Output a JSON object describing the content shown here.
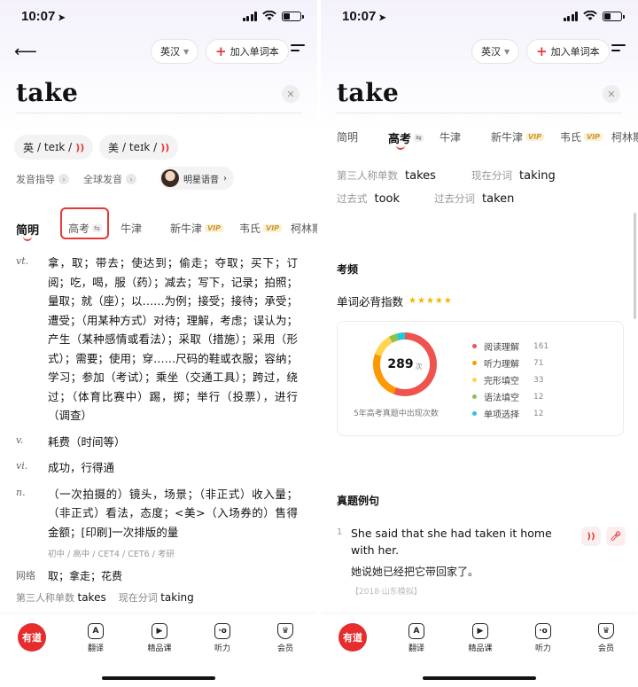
{
  "status": {
    "time": "10:07",
    "location_icon": "location-arrow-icon"
  },
  "nav": {
    "dict_selector": "英汉",
    "add_vocab": "加入单词本"
  },
  "word": "take",
  "pron": [
    {
      "region": "英",
      "ipa": "/ teɪk /"
    },
    {
      "region": "美",
      "ipa": "/ teɪk /"
    }
  ],
  "subrow": {
    "guide": "发音指导",
    "global": "全球发音",
    "celebrity": "明星语音"
  },
  "tabs": [
    {
      "label": "简明"
    },
    {
      "label": "高考"
    },
    {
      "label": "牛津"
    },
    {
      "label": "新牛津",
      "badge": "VIP"
    },
    {
      "label": "韦氏",
      "badge": "VIP"
    },
    {
      "label": "柯林斯"
    }
  ],
  "definitions": [
    {
      "pos": "vt.",
      "text": "拿，取；带去；使达到；偷走；夺取；买下；订阅；吃，喝，服（药）；减去；写下，记录；拍照；量取；就（座）；以……为例；接受；接待；承受；遭受；（用某种方式）对待；理解，考虑；误认为；产生（某种感情或看法）；采取（措施）；采用（形式）；需要；使用；穿……尺码的鞋或衣服；容纳；学习；参加（考试）；乘坐（交通工具）；跨过，绕过；（体育比赛中）踢，掷；举行（投票），进行（调查）"
    },
    {
      "pos": "v.",
      "text": "耗费（时间等）"
    },
    {
      "pos": "vi.",
      "text": "成功，行得通"
    },
    {
      "pos": "n.",
      "text": "（一次拍摄的）镜头，场景；（非正式）收入量；（非正式）看法，态度；<美>（入场券的）售得金额；[印刷]一次排版的量"
    }
  ],
  "exam_tags": "初中 / 高中 / CET4 / CET6 / 考研",
  "phrases": {
    "label": "网络",
    "text": "取；拿走；花费"
  },
  "forms": [
    {
      "label": "第三人称单数",
      "value": "takes"
    },
    {
      "label": "现在分词",
      "value": "taking"
    },
    {
      "label": "过去式",
      "value": "took"
    },
    {
      "label": "过去分词",
      "value": "taken"
    }
  ],
  "freq": {
    "section": "考频",
    "recite_label": "单词必背指数",
    "stars": "★★★★★",
    "total": "289",
    "unit": "次",
    "caption": "5年高考真题中出现次数"
  },
  "chart_data": {
    "type": "pie",
    "categories": [
      "阅读理解",
      "听力理解",
      "完形填空",
      "语法填空",
      "单项选择"
    ],
    "values": [
      161,
      71,
      33,
      12,
      12
    ],
    "colors": [
      "#ef5350",
      "#ff9800",
      "#ffd54f",
      "#8bc34a",
      "#26c6da"
    ]
  },
  "examples": {
    "section": "真题例句",
    "items": [
      {
        "num": "1",
        "en": "She said that she had taken it home with her.",
        "cn": "她说她已经把它带回家了。",
        "source": "【2018·山东模拟】"
      }
    ]
  },
  "bottombar": {
    "logo": "有道",
    "items": [
      "翻译",
      "精品课",
      "听力",
      "会员"
    ]
  }
}
